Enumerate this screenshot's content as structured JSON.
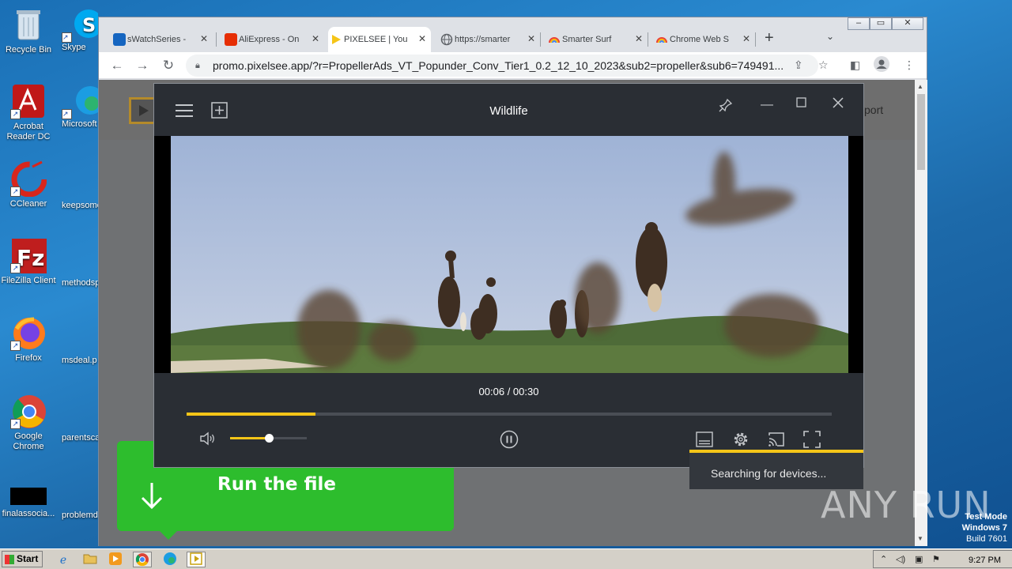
{
  "desktop": {
    "icons_col1": [
      {
        "label": "Recycle Bin",
        "icon": "recycle-bin-icon"
      },
      {
        "label": "Acrobat Reader DC",
        "icon": "acrobat-icon"
      },
      {
        "label": "CCleaner",
        "icon": "ccleaner-icon"
      },
      {
        "label": "FileZilla Client",
        "icon": "filezilla-icon"
      },
      {
        "label": "Firefox",
        "icon": "firefox-icon"
      },
      {
        "label": "Google Chrome",
        "icon": "chrome-icon"
      },
      {
        "label": "finalassocia...",
        "icon": "file-icon"
      }
    ],
    "icons_col2": [
      {
        "label": "Skype",
        "icon": "skype-icon"
      },
      {
        "label": "Microsoft",
        "icon": "edge-icon"
      },
      {
        "label": "keepsome",
        "icon": "file-icon"
      },
      {
        "label": "methodsp",
        "icon": "file-icon"
      },
      {
        "label": "msdeal.p",
        "icon": "file-icon"
      },
      {
        "label": "parentsca",
        "icon": "file-icon"
      },
      {
        "label": "problemd",
        "icon": "file-icon"
      }
    ]
  },
  "browser": {
    "tabs": [
      {
        "title": "sWatchSeries -",
        "favicon": "site-favicon",
        "color": "#1565c0"
      },
      {
        "title": "AliExpress - On",
        "favicon": "aliexpress-favicon",
        "color": "#e62e04"
      },
      {
        "title": "PIXELSEE | You",
        "favicon": "pixelsee-favicon",
        "color": "#f5c518"
      },
      {
        "title": "https://smarter",
        "favicon": "globe-icon",
        "color": "#5f6368"
      },
      {
        "title": "Smarter Surf",
        "favicon": "rainbow-favicon",
        "color": "#4285f4"
      },
      {
        "title": "Chrome Web S",
        "favicon": "rainbow-favicon",
        "color": "#4285f4"
      }
    ],
    "url": "promo.pixelsee.app/?r=PropellerAds_VT_Popunder_Conv_Tier1_0.2_12_10_2023&sub2=propeller&sub6=749491..."
  },
  "site": {
    "nav_partial": "port",
    "run_file_label": "Run the file"
  },
  "player": {
    "title": "Wildlife",
    "time": "00:06 / 00:30",
    "progress": 0.2,
    "volume": 0.5,
    "cast_status": "Searching for devices...",
    "accent": "#f5c518"
  },
  "watermark": {
    "text": "ANY RUN",
    "test_mode": "Test Mode",
    "os": "Windows 7",
    "build": "Build 7601"
  },
  "taskbar": {
    "start_label": "Start",
    "clock": "9:27 PM"
  }
}
